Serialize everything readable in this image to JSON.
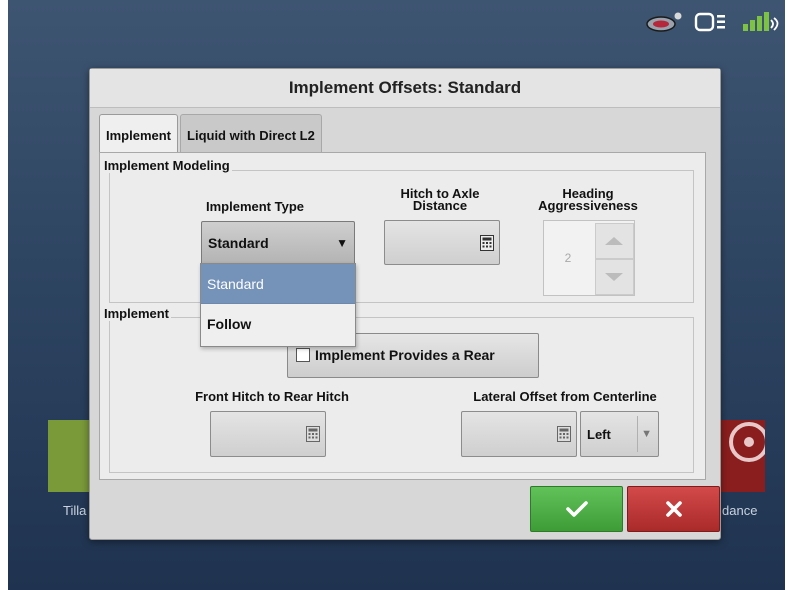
{
  "dialog": {
    "title": "Implement Offsets: Standard",
    "tabs": [
      {
        "label": "Implement",
        "active": true
      },
      {
        "label": "Liquid with Direct L2",
        "active": false
      }
    ]
  },
  "modeling": {
    "group_title": "Implement Modeling",
    "implement_type_label": "Implement Type",
    "implement_type_value": "Standard",
    "dropdown_options": [
      "Standard",
      "Follow"
    ],
    "hitch_label_line1": "Hitch to Axle",
    "hitch_label_line2": "Distance",
    "heading_label_line1": "Heading",
    "heading_label_line2": "Aggressiveness",
    "heading_value": "2"
  },
  "offsets": {
    "group_title": "Implement",
    "rear_checkbox_label": "Implement Provides a Rear",
    "rear_checked": false,
    "front_hitch_label": "Front Hitch to Rear Hitch",
    "lateral_label": "Lateral Offset from Centerline",
    "lateral_side_value": "Left"
  },
  "background": {
    "left_tile_label": "Tilla",
    "right_tile_label": "dance"
  },
  "colors": {
    "ok": "#4caf45",
    "cancel": "#c03a3a",
    "selected_option": "#7592b8"
  }
}
